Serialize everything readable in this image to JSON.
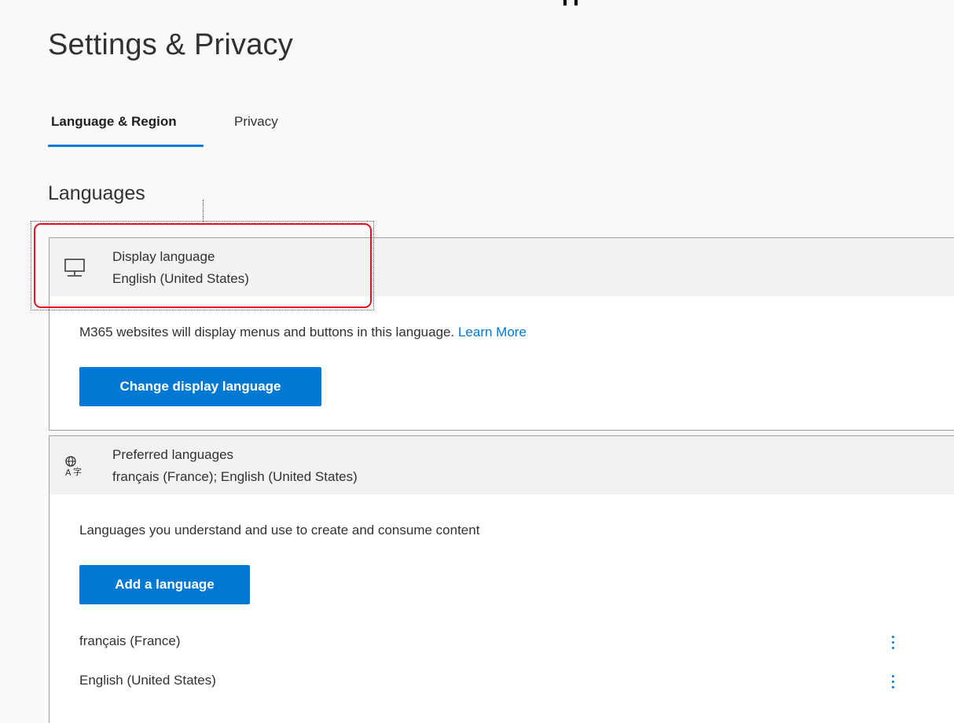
{
  "page": {
    "title": "Settings & Privacy"
  },
  "tabs": [
    {
      "label": "Language & Region",
      "selected": true
    },
    {
      "label": "Privacy",
      "selected": false
    }
  ],
  "section": {
    "heading": "Languages"
  },
  "display_language": {
    "icon": "monitor-icon",
    "title": "Display language",
    "value": "English (United States)",
    "description": "M365 websites will display menus and buttons in this language.",
    "link_label": "Learn More",
    "button_label": "Change display language"
  },
  "preferred_languages": {
    "icon": "language-translate-icon",
    "title": "Preferred languages",
    "value": "français (France); English (United States)",
    "description": "Languages you understand and use to create and consume content",
    "button_label": "Add a language",
    "items": [
      {
        "name": "français (France)",
        "menu_icon": "more-vertical-icon"
      },
      {
        "name": "English (United States)",
        "menu_icon": "more-vertical-icon"
      }
    ]
  },
  "colors": {
    "accent": "#0078d4",
    "highlight": "#e81123",
    "header_bg": "#f3f2f1",
    "page_bg": "#faf9f8"
  }
}
